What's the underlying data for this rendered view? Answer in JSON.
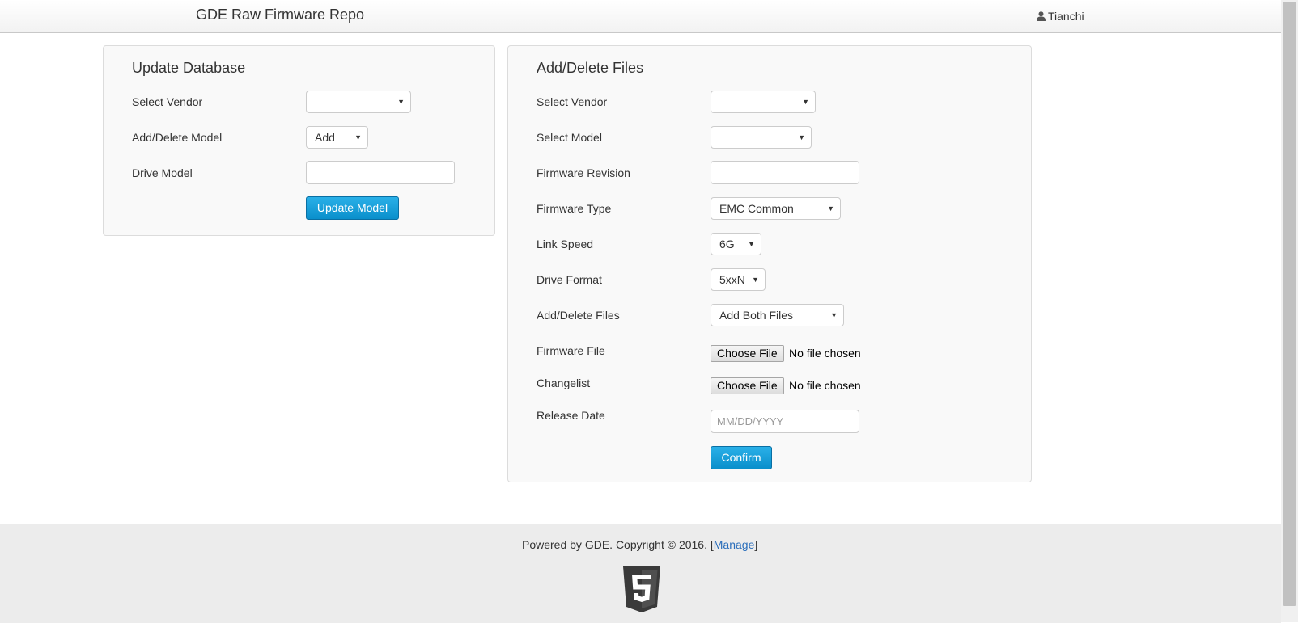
{
  "header": {
    "title": "GDE Raw Firmware Repo",
    "user": "Tianchi"
  },
  "update_panel": {
    "title": "Update Database",
    "vendor_label": "Select Vendor",
    "vendor_value": "",
    "model_action_label": "Add/Delete Model",
    "model_action_value": "Add",
    "drive_model_label": "Drive Model",
    "drive_model_value": "",
    "button_label": "Update Model"
  },
  "files_panel": {
    "title": "Add/Delete Files",
    "vendor_label": "Select Vendor",
    "vendor_value": "",
    "model_label": "Select Model",
    "model_value": "",
    "revision_label": "Firmware Revision",
    "revision_value": "",
    "type_label": "Firmware Type",
    "type_value": "EMC Common",
    "speed_label": "Link Speed",
    "speed_value": "6G",
    "format_label": "Drive Format",
    "format_value": "5xxN",
    "action_label": "Add/Delete Files",
    "action_value": "Add Both Files",
    "firmware_file_label": "Firmware File",
    "changelist_label": "Changelist",
    "choose_file_label": "Choose File",
    "no_file_text": "No file chosen",
    "release_date_label": "Release Date",
    "release_date_placeholder": "MM/DD/YYYY",
    "confirm_label": "Confirm"
  },
  "footer": {
    "text": "Powered by GDE. Copyright © 2016. [",
    "manage_link": "Manage",
    "text_end": "]",
    "logo_icon": "html5-shield-icon"
  },
  "colors": {
    "primary_button": "#0a8fcb",
    "link": "#2a6ebb"
  }
}
